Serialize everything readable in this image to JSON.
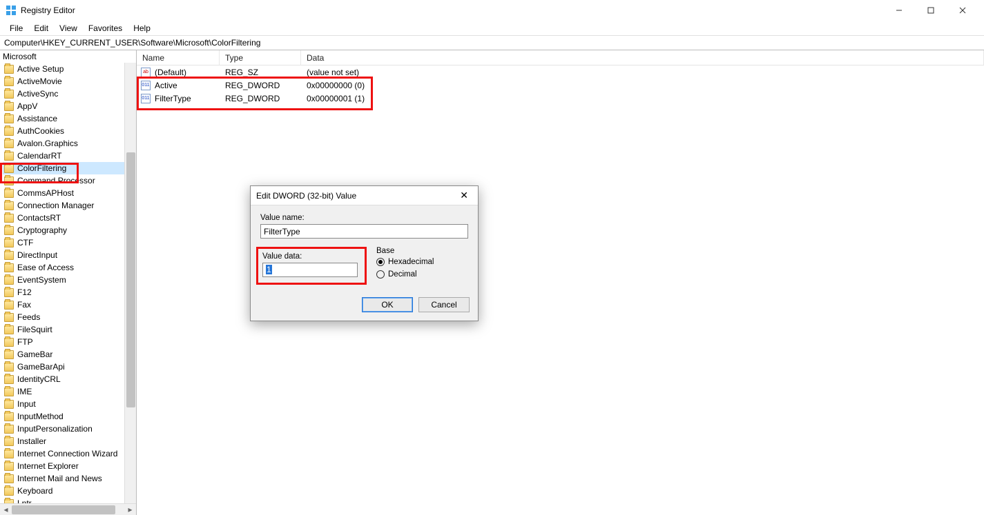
{
  "window": {
    "title": "Registry Editor"
  },
  "menu": {
    "items": [
      "File",
      "Edit",
      "View",
      "Favorites",
      "Help"
    ]
  },
  "address": "Computer\\HKEY_CURRENT_USER\\Software\\Microsoft\\ColorFiltering",
  "tree": {
    "root": "Microsoft",
    "items": [
      "Active Setup",
      "ActiveMovie",
      "ActiveSync",
      "AppV",
      "Assistance",
      "AuthCookies",
      "Avalon.Graphics",
      "CalendarRT",
      "ColorFiltering",
      "Command Processor",
      "CommsAPHost",
      "Connection Manager",
      "ContactsRT",
      "Cryptography",
      "CTF",
      "DirectInput",
      "Ease of Access",
      "EventSystem",
      "F12",
      "Fax",
      "Feeds",
      "FileSquirt",
      "FTP",
      "GameBar",
      "GameBarApi",
      "IdentityCRL",
      "IME",
      "Input",
      "InputMethod",
      "InputPersonalization",
      "Installer",
      "Internet Connection Wizard",
      "Internet Explorer",
      "Internet Mail and News",
      "Keyboard",
      "Lntr"
    ],
    "selected": "ColorFiltering"
  },
  "list": {
    "columns": {
      "name": "Name",
      "type": "Type",
      "data": "Data"
    },
    "rows": [
      {
        "icon": "str",
        "name": "(Default)",
        "type": "REG_SZ",
        "data": "(value not set)"
      },
      {
        "icon": "dw",
        "name": "Active",
        "type": "REG_DWORD",
        "data": "0x00000000 (0)"
      },
      {
        "icon": "dw",
        "name": "FilterType",
        "type": "REG_DWORD",
        "data": "0x00000001 (1)"
      }
    ]
  },
  "dialog": {
    "title": "Edit DWORD (32-bit) Value",
    "value_name_label": "Value name:",
    "value_name": "FilterType",
    "value_data_label": "Value data:",
    "value_data": "1",
    "base_label": "Base",
    "radio_hex": "Hexadecimal",
    "radio_dec": "Decimal",
    "base_selected": "hex",
    "ok": "OK",
    "cancel": "Cancel"
  }
}
